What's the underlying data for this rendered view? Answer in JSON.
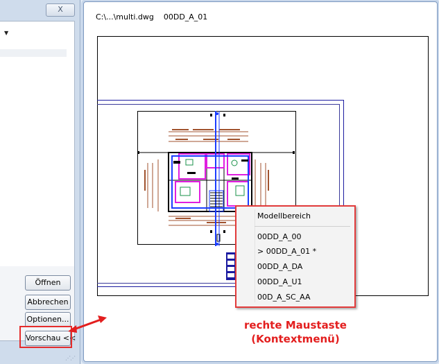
{
  "left_dialog": {
    "close_glyph": "X",
    "buttons": {
      "open": "Öffnen",
      "cancel": "Abbrechen",
      "options": "Optionen...",
      "preview": "Vorschau <<"
    }
  },
  "preview_window": {
    "title": "C:\\...\\multi.dwg    00DD_A_01"
  },
  "context_menu": {
    "items": [
      "Modellbereich",
      "00DD_A_00",
      "> 00DD_A_01 *",
      "00DD_A_DA",
      "00DD_A_U1",
      "00D_A_SC_AA"
    ]
  },
  "annotation": {
    "line1": "rechte Maustaste",
    "line2": "(Kontextmenü)"
  },
  "colors": {
    "highlight_red": "#e52c2c",
    "annotation_red": "#e31e1e",
    "plan_brown": "#a0522d",
    "plan_blue": "#1a3cff",
    "plan_magenta": "#e01ee0"
  }
}
